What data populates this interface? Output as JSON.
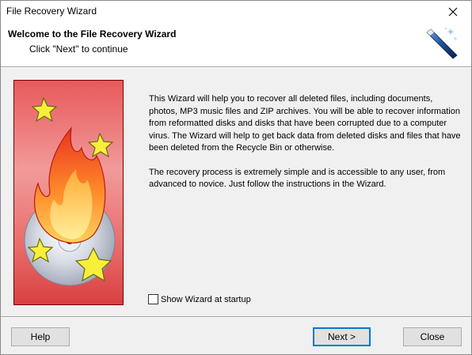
{
  "window": {
    "title": "File Recovery Wizard"
  },
  "header": {
    "title": "Welcome to the File Recovery Wizard",
    "subtitle": "Click \"Next\" to continue"
  },
  "main": {
    "paragraph1": "This Wizard will help you to recover all deleted files, including documents, photos, MP3 music files and ZIP archives. You will be able to recover information from reformatted disks and disks that have been corrupted due to a computer virus. The Wizard will help to get back data from deleted disks and files that have been deleted from the Recycle Bin or otherwise.",
    "paragraph2": "The recovery process is extremely simple and is accessible to any user, from advanced to novice. Just follow the instructions in the Wizard.",
    "show_wizard_label": "Show Wizard at startup",
    "show_wizard_checked": false
  },
  "footer": {
    "help_label": "Help",
    "next_label": "Next >",
    "close_label": "Close"
  },
  "icons": {
    "close": "close-icon",
    "wand": "magic-wand-icon",
    "sidebar": "fire-cd-stars-illustration"
  }
}
